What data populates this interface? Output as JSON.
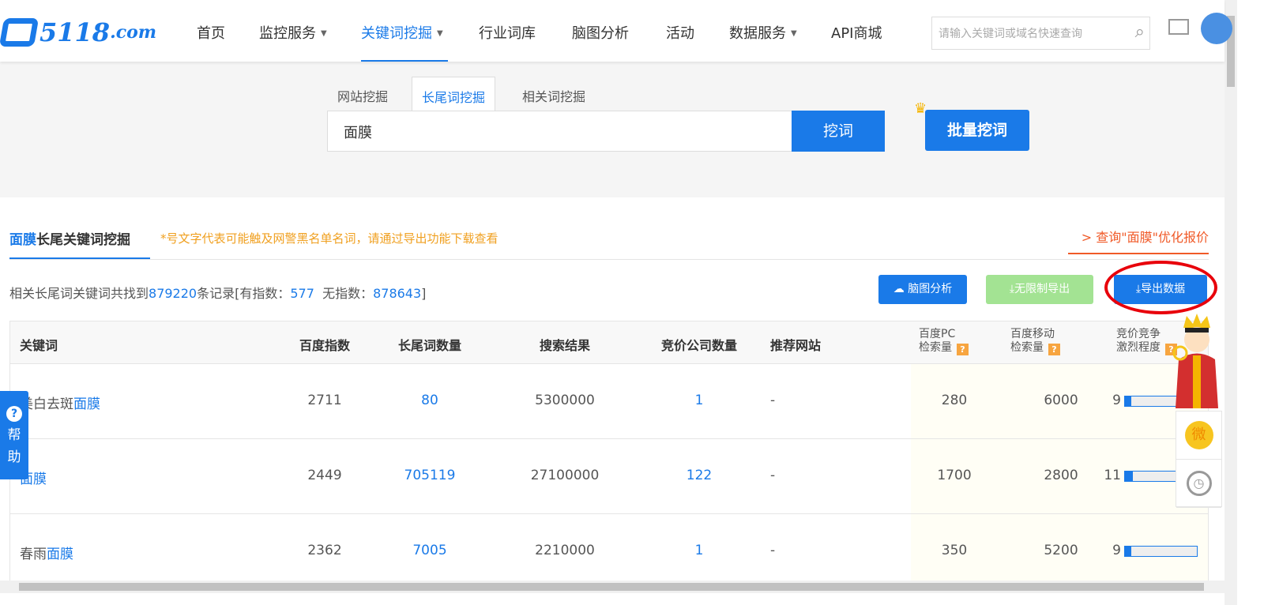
{
  "nav": {
    "logo": "5118",
    "logo_suffix": ".com",
    "items": [
      {
        "label": "首页"
      },
      {
        "label": "监控服务",
        "caret": true
      },
      {
        "label": "关键词挖掘",
        "caret": true,
        "active": true
      },
      {
        "label": "行业词库"
      },
      {
        "label": "脑图分析"
      },
      {
        "label": "活动"
      },
      {
        "label": "数据服务",
        "caret": true
      },
      {
        "label": "API商城"
      }
    ],
    "search_placeholder": "请输入关键词或域名快速查询"
  },
  "search": {
    "tabs": [
      "网站挖掘",
      "长尾词挖掘",
      "相关词挖掘"
    ],
    "value": "面膜",
    "dig_label": "挖词",
    "batch_label": "批量挖词"
  },
  "section": {
    "title_keyword": "面膜",
    "title_rest": "长尾关键词挖掘",
    "note": "*号文字代表可能触及网警黑名单名词，请通过导出功能下载查看",
    "quote_link": "> 查询\"面膜\"优化报价"
  },
  "summary": {
    "prefix": "相关长尾词关键词共找到",
    "total": "879220",
    "mid1": "条记录[有指数：",
    "with_index": "577",
    "mid2": "无指数：",
    "without_index": "878643",
    "suffix": "]"
  },
  "actions": {
    "mindmap": "脑图分析",
    "unlimited_export": "无限制导出",
    "export": "导出数据"
  },
  "table": {
    "headers": [
      "关键词",
      "百度指数",
      "长尾词数量",
      "搜索结果",
      "竞价公司数量",
      "推荐网站"
    ],
    "headers2": [
      [
        "百度PC",
        "检索量"
      ],
      [
        "百度移动",
        "检索量"
      ],
      [
        "竞价竞争",
        "激烈程度"
      ]
    ],
    "rows": [
      {
        "kw_pre": "美白去斑",
        "kw_hl": "面膜",
        "index": "2711",
        "longtail": "80",
        "results": "5300000",
        "bid": "1",
        "site": "-",
        "pc": "280",
        "mobile": "6000",
        "comp": "9",
        "comp_pct": 9
      },
      {
        "kw_pre": "",
        "kw_hl": "面膜",
        "index": "2449",
        "longtail": "705119",
        "results": "27100000",
        "bid": "122",
        "site": "-",
        "pc": "1700",
        "mobile": "2800",
        "comp": "11",
        "comp_pct": 11
      },
      {
        "kw_pre": "春雨",
        "kw_hl": "面膜",
        "index": "2362",
        "longtail": "7005",
        "results": "2210000",
        "bid": "1",
        "site": "-",
        "pc": "350",
        "mobile": "5200",
        "comp": "9",
        "comp_pct": 9
      }
    ]
  },
  "help": {
    "label1": "帮",
    "label2": "助"
  },
  "side": {
    "wechat": "微"
  }
}
